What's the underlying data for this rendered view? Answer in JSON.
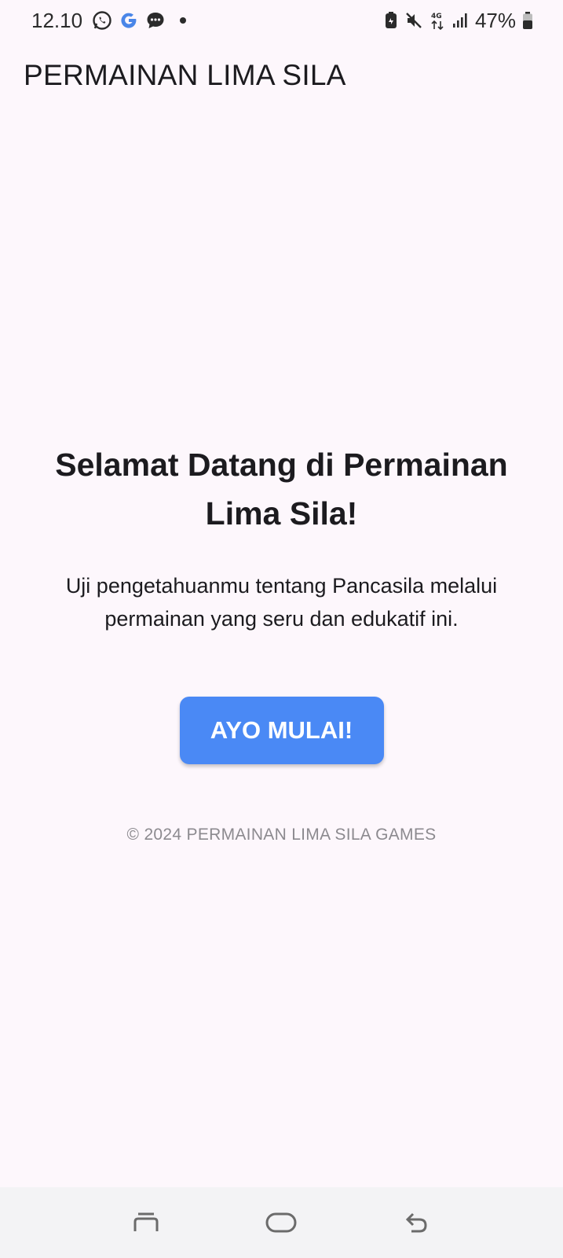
{
  "status_bar": {
    "time": "12.10",
    "battery": "47%",
    "icons_left": [
      "whatsapp-icon",
      "google-icon",
      "messages-icon",
      "notification-dot-icon"
    ],
    "icons_right": [
      "battery-saver-icon",
      "mute-icon",
      "network-4g-icon",
      "signal-icon",
      "battery-icon"
    ]
  },
  "app_bar": {
    "title": "PERMAINAN LIMA SILA"
  },
  "main": {
    "welcome_title": "Selamat Datang di Permainan Lima Sila!",
    "welcome_subtitle": "Uji pengetahuanmu tentang Pancasila melalui permainan yang seru dan edukatif ini.",
    "start_button_label": "AYO MULAI!",
    "copyright": "© 2024 PERMAINAN LIMA SILA GAMES"
  },
  "nav_bar": {
    "buttons": [
      "recent-apps-icon",
      "home-icon",
      "back-icon"
    ]
  },
  "colors": {
    "background": "#fdf7fc",
    "button": "#4a89f5",
    "button_text": "#ffffff",
    "copyright": "#8c8a8f",
    "nav_bar": "#f3f3f5"
  }
}
